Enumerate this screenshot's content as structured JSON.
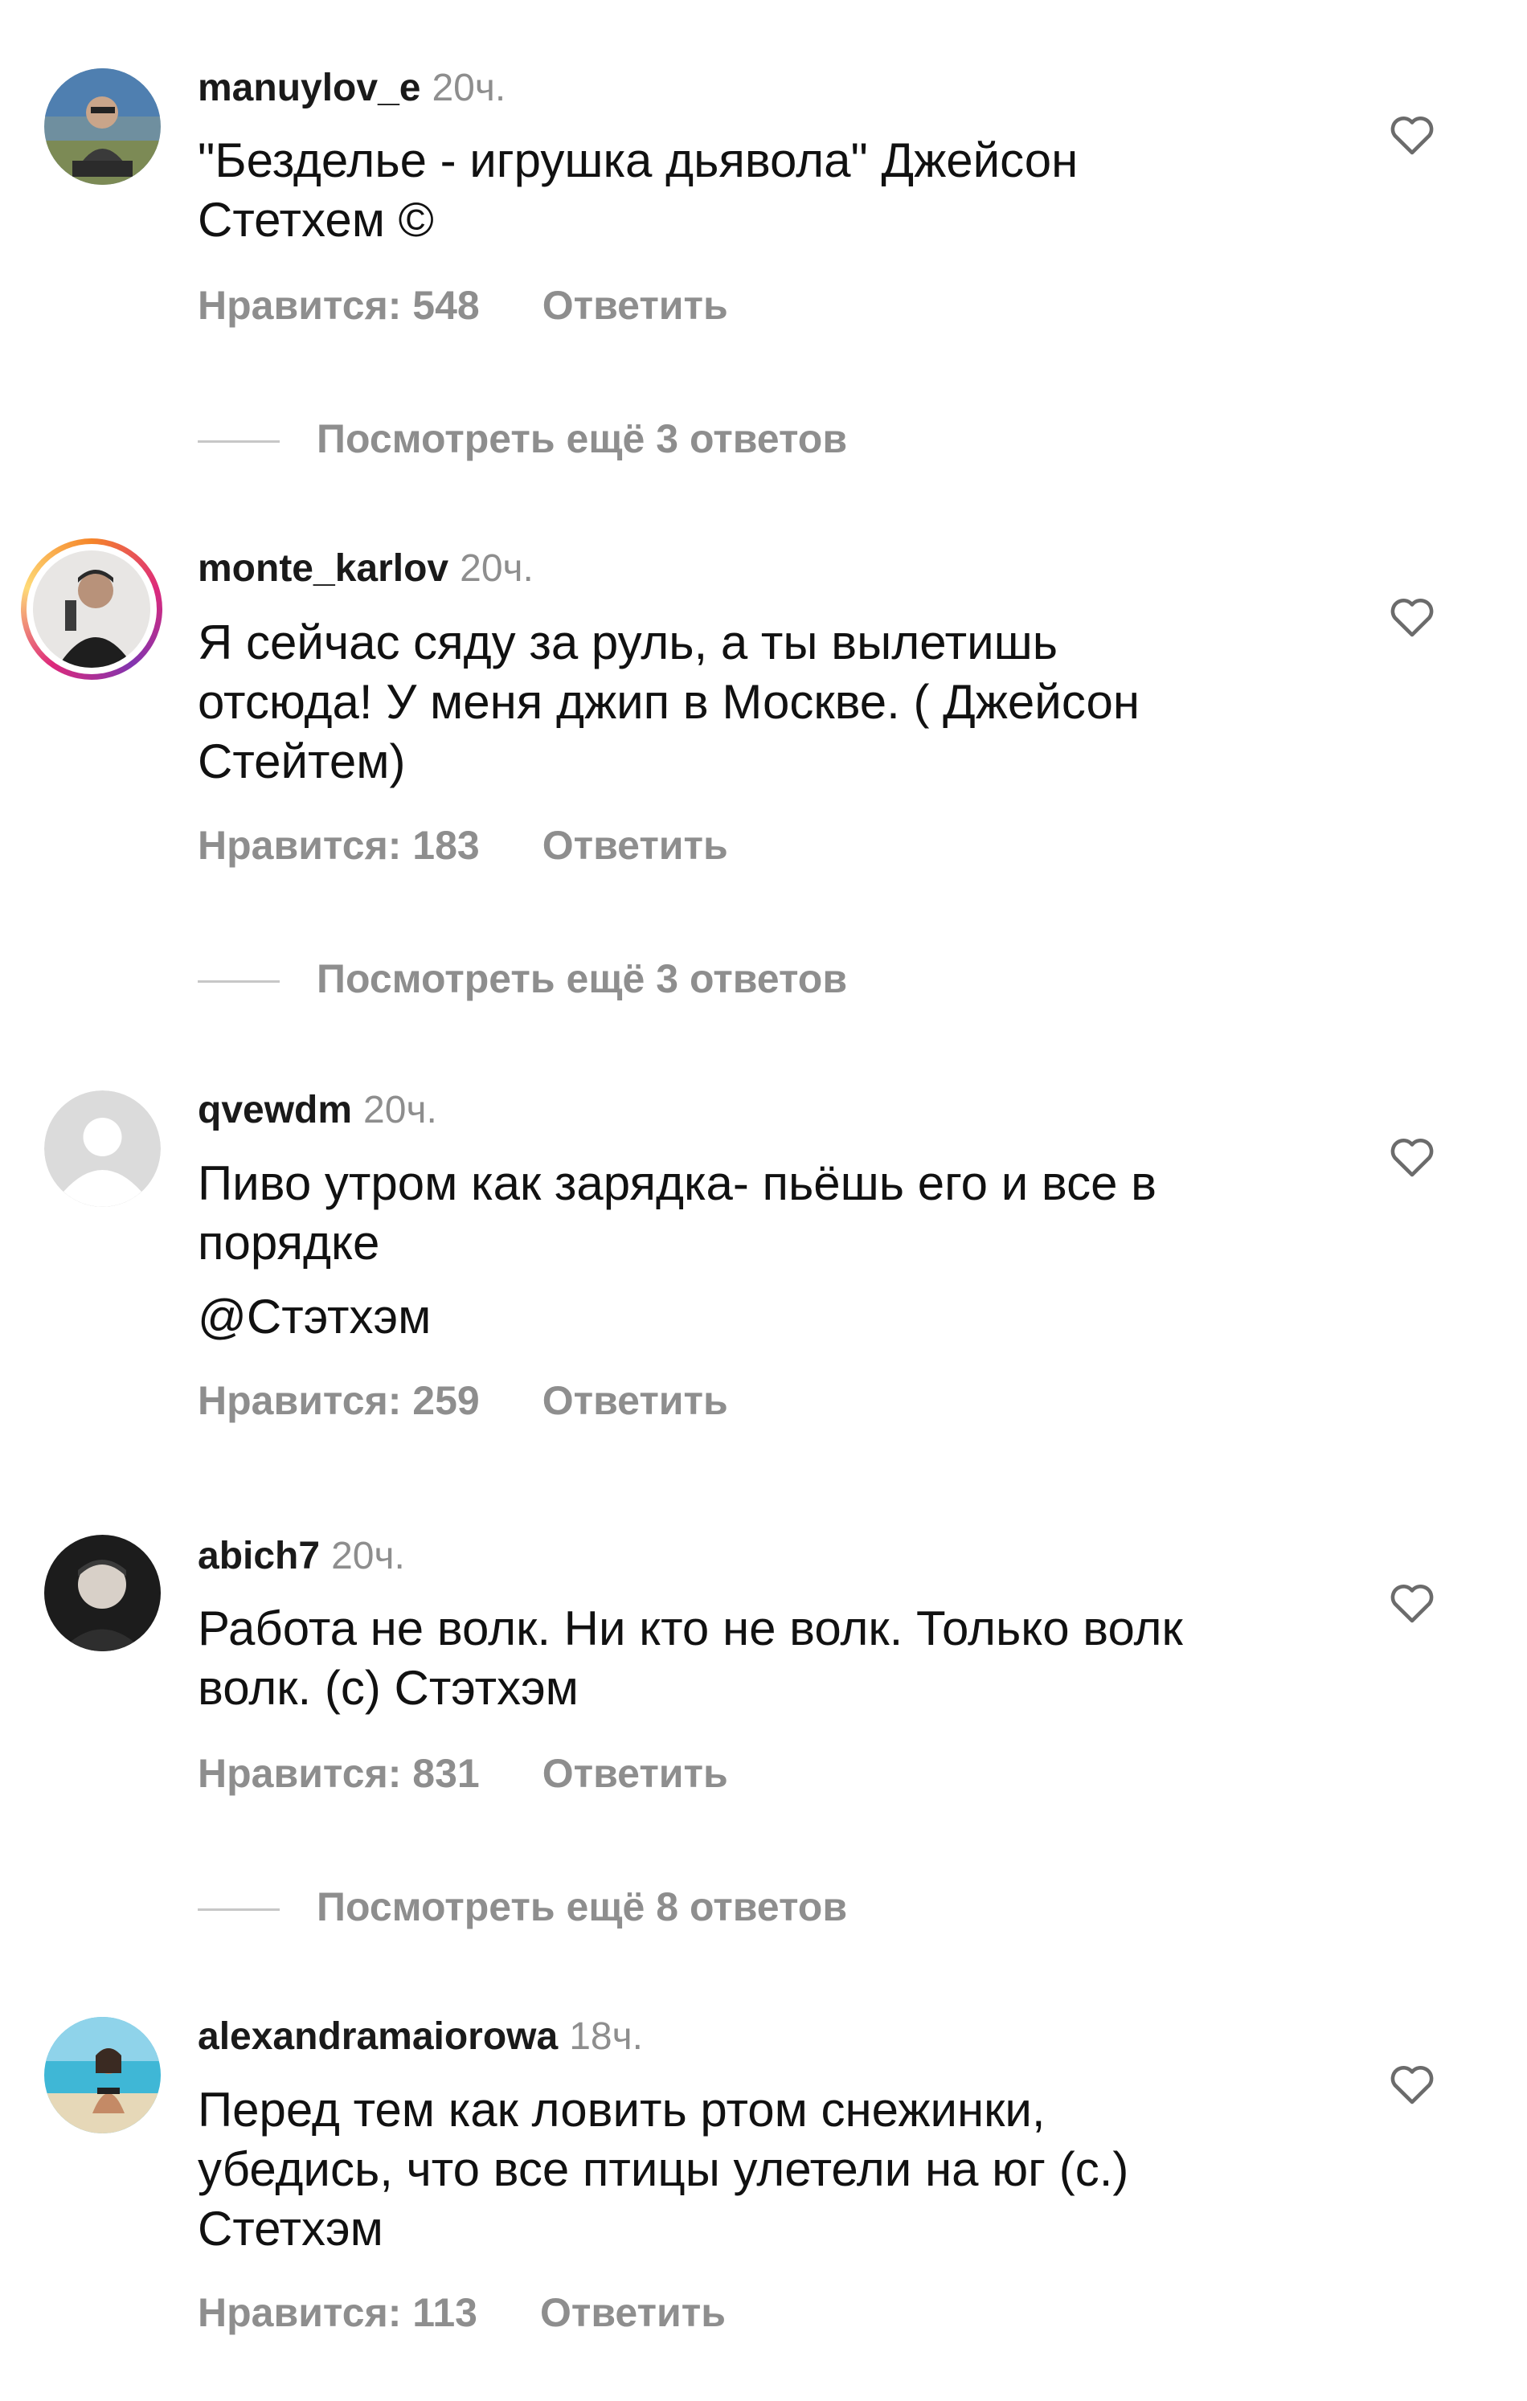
{
  "comments": [
    {
      "username": "manuylov_e",
      "time": "20ч.",
      "lines": [
        "\"Безделье - игрушка дьявола\" Джейсон",
        "Стетхем ©"
      ],
      "likes": "Нравится: 548",
      "reply": "Ответить",
      "view_replies": "Посмотреть ещё 3 ответов"
    },
    {
      "username": "monte_karlov",
      "time": "20ч.",
      "lines": [
        "Я сейчас сяду за руль, а ты вылетишь",
        "отсюда! У меня джип в Москве. ( Джейсон",
        "Стейтем)"
      ],
      "likes": "Нравится: 183",
      "reply": "Ответить",
      "view_replies": "Посмотреть ещё 3 ответов"
    },
    {
      "username": "qvewdm",
      "time": "20ч.",
      "lines": [
        "Пиво утром как зарядка- пьёшь его и все в",
        "порядке"
      ],
      "mention": "@Стэтхэм",
      "likes": "Нравится: 259",
      "reply": "Ответить"
    },
    {
      "username": "abich7",
      "time": "20ч.",
      "lines": [
        "Работа не волк. Ни кто не волк. Только волк",
        "волк. (с) Стэтхэм"
      ],
      "likes": "Нравится: 831",
      "reply": "Ответить",
      "view_replies": "Посмотреть ещё 8 ответов"
    },
    {
      "username": "alexandramaiorowa",
      "time": "18ч.",
      "lines": [
        "Перед тем как ловить ртом снежинки,",
        "убедись, что все птицы улетели на юг (с.)",
        "Стетхэм"
      ],
      "likes": "Нравится: 113",
      "reply": "Ответить"
    }
  ],
  "icons": {
    "like": "heart-outline-icon",
    "default_avatar": "default-avatar-icon"
  },
  "colors": {
    "secondary_text": "#8e8e8e",
    "primary_text": "#111111",
    "divider": "#c7c7c7",
    "story_ring": "#dd2a7b"
  }
}
